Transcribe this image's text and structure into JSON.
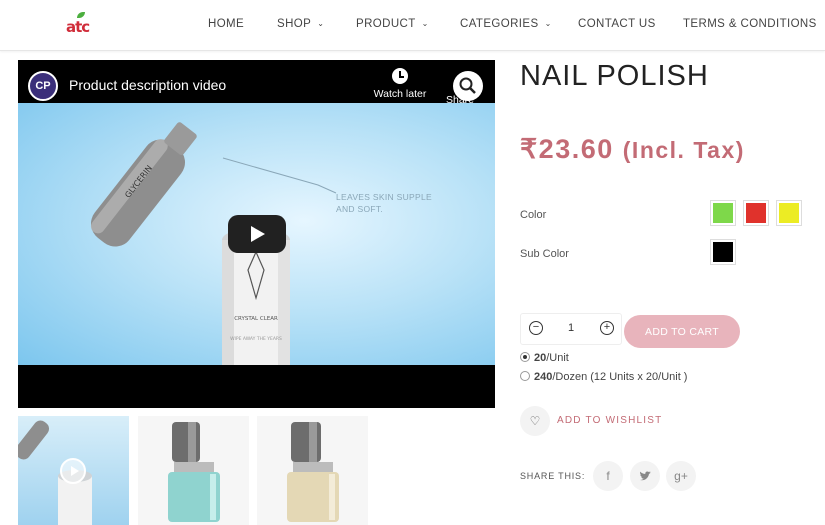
{
  "header": {
    "logo_text": "atc",
    "nav": [
      {
        "label": "HOME",
        "has_caret": false
      },
      {
        "label": "SHOP",
        "has_caret": true
      },
      {
        "label": "PRODUCT",
        "has_caret": true
      },
      {
        "label": "CATEGORIES",
        "has_caret": true
      },
      {
        "label": "CONTACT US",
        "has_caret": false
      },
      {
        "label": "TERMS & CONDITIONS",
        "has_caret": false
      }
    ]
  },
  "video": {
    "channel_badge": "CP",
    "title": "Product description video",
    "watch_later": "Watch later",
    "share": "Share",
    "scene_text_line1": "LEAVES SKIN SUPPLE",
    "scene_text_line2": "AND SOFT.",
    "bottle1_label": "GLYCERIN",
    "bottle2_label": "CRYSTAL CLEAR",
    "bottle2_sublabel": "WIPE AWAY THE YEARS"
  },
  "thumbnails": [
    {
      "name": "video-thumbnail",
      "has_play": true
    },
    {
      "name": "teal-nail-polish",
      "color": "#8fd3cf"
    },
    {
      "name": "gold-nail-polish",
      "color": "#e4d8b5"
    }
  ],
  "product": {
    "title": "NAIL POLISH",
    "price": "₹23.60",
    "price_note": "(Incl. Tax)",
    "color_label": "Color",
    "colors": [
      "#7ed84a",
      "#e0322c",
      "#ecec24"
    ],
    "subcolor_label": "Sub Color",
    "subcolors": [
      "#000000"
    ],
    "quantity": "1",
    "add_to_cart": "ADD TO CART",
    "units": [
      {
        "qty": "20",
        "text": "/Unit",
        "selected": true
      },
      {
        "qty": "240",
        "text": "/Dozen (12 Units x 20/Unit )",
        "selected": false
      }
    ],
    "wishlist": "ADD TO WISHLIST",
    "share_this": "SHARE THIS:"
  },
  "social": [
    {
      "name": "facebook-icon",
      "glyph": "f"
    },
    {
      "name": "twitter-icon",
      "glyph": "t"
    },
    {
      "name": "google-plus-icon",
      "glyph": "g+"
    }
  ]
}
